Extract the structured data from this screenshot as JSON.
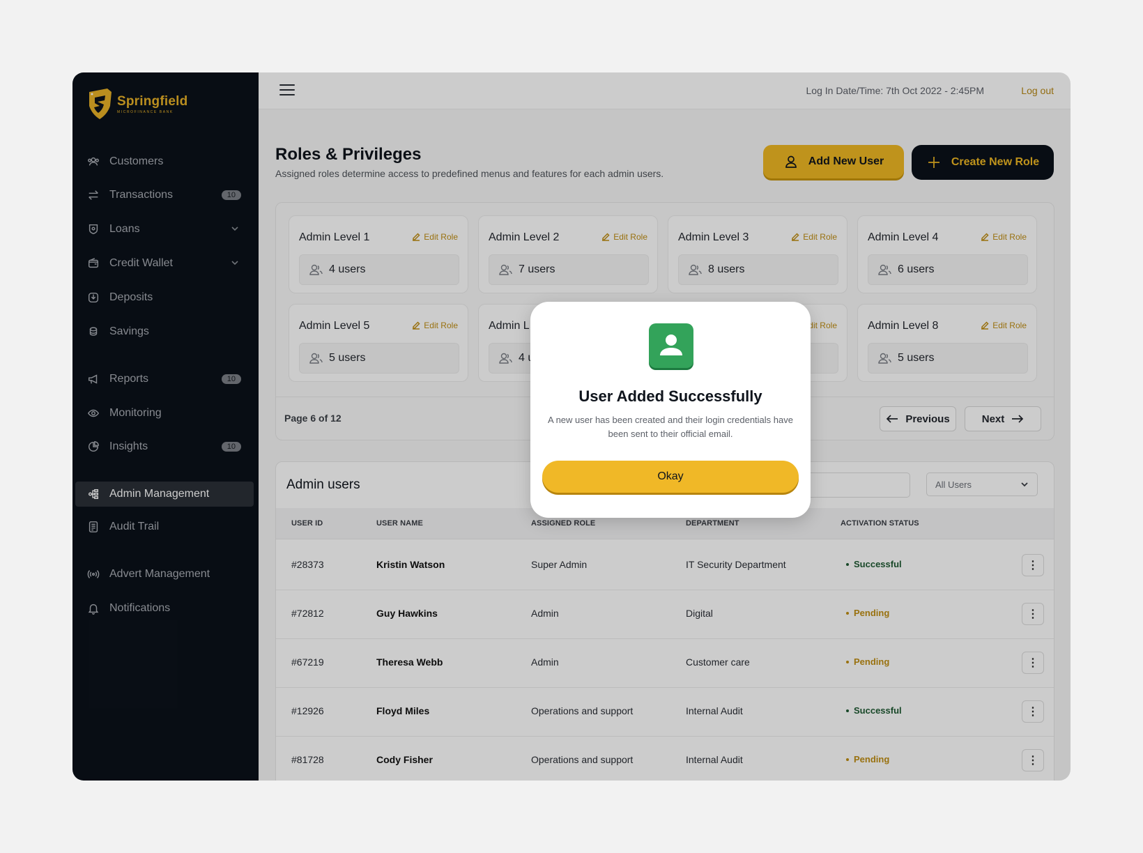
{
  "brand": {
    "name": "Springfield",
    "tagline": "MICROFINANCE BANK",
    "accent": "#efb823",
    "dark": "#0b111a"
  },
  "sidebar": {
    "items": [
      {
        "label": "Customers",
        "icon": "customers-icon",
        "badge": ""
      },
      {
        "label": "Transactions",
        "icon": "transactions-icon",
        "badge": "10"
      },
      {
        "label": "Loans",
        "icon": "loans-icon",
        "badge": "",
        "chevron": true
      },
      {
        "label": "Credit Wallet",
        "icon": "wallet-icon",
        "badge": "",
        "chevron": true
      },
      {
        "label": "Deposits",
        "icon": "deposits-icon",
        "badge": ""
      },
      {
        "label": "Savings",
        "icon": "savings-icon",
        "badge": ""
      },
      {
        "label": "Reports",
        "icon": "megaphone-icon",
        "badge": "10"
      },
      {
        "label": "Monitoring",
        "icon": "eye-icon",
        "badge": ""
      },
      {
        "label": "Insights",
        "icon": "pie-chart-icon",
        "badge": "10"
      },
      {
        "label": "Admin Management",
        "icon": "admin-icon",
        "badge": "",
        "active": true
      },
      {
        "label": "Audit Trail",
        "icon": "document-icon",
        "badge": ""
      },
      {
        "label": "Advert Management",
        "icon": "broadcast-icon",
        "badge": ""
      },
      {
        "label": "Notifications",
        "icon": "bell-icon",
        "badge": ""
      }
    ]
  },
  "topbar": {
    "login_time": "Log In Date/Time: 7th Oct 2022 - 2:45PM",
    "logout": "Log out"
  },
  "header": {
    "title": "Roles & Privileges",
    "subtitle": "Assigned roles determine access to predefined menus and features for each admin users.",
    "add_user": "Add New User",
    "create_role": "Create New Role"
  },
  "roles": {
    "edit_label": "Edit Role",
    "cards": [
      {
        "name": "Admin Level 1",
        "users": "4 users"
      },
      {
        "name": "Admin Level 2",
        "users": "7 users"
      },
      {
        "name": "Admin Level 3",
        "users": "8 users"
      },
      {
        "name": "Admin Level 4",
        "users": "6 users"
      },
      {
        "name": "Admin Level 5",
        "users": "5 users"
      },
      {
        "name": "Admin L",
        "users": "4 u"
      },
      {
        "name": "",
        "users": ""
      },
      {
        "name": "Admin Level 8",
        "users": "5 users"
      }
    ],
    "page_info": "Page 6 of 12",
    "previous": "Previous",
    "next": "Next"
  },
  "users": {
    "title": "Admin users",
    "filter": "All Users",
    "columns": [
      "USER ID",
      "USER NAME",
      "ASSIGNED ROLE",
      "DEPARTMENT",
      "ACTIVATION STATUS"
    ],
    "rows": [
      {
        "id": "#28373",
        "name": "Kristin Watson",
        "role": "Super Admin",
        "dept": "IT Security Department",
        "status": "Successful"
      },
      {
        "id": "#72812",
        "name": "Guy Hawkins",
        "role": "Admin",
        "dept": "Digital",
        "status": "Pending"
      },
      {
        "id": "#67219",
        "name": "Theresa Webb",
        "role": "Admin",
        "dept": "Customer care",
        "status": "Pending"
      },
      {
        "id": "#12926",
        "name": "Floyd Miles",
        "role": "Operations and support",
        "dept": "Internal Audit",
        "status": "Successful"
      },
      {
        "id": "#81728",
        "name": "Cody Fisher",
        "role": "Operations and support",
        "dept": "Internal Audit",
        "status": "Pending"
      }
    ],
    "status_colors": {
      "Successful": "#1f5a33",
      "Pending": "#c08e13"
    }
  },
  "modal": {
    "title": "User Added Successfully",
    "text": "A new user has been created and their login credentials have been sent to their official email.",
    "button": "Okay",
    "icon": "user-success-icon",
    "icon_color": "#33a35a"
  }
}
